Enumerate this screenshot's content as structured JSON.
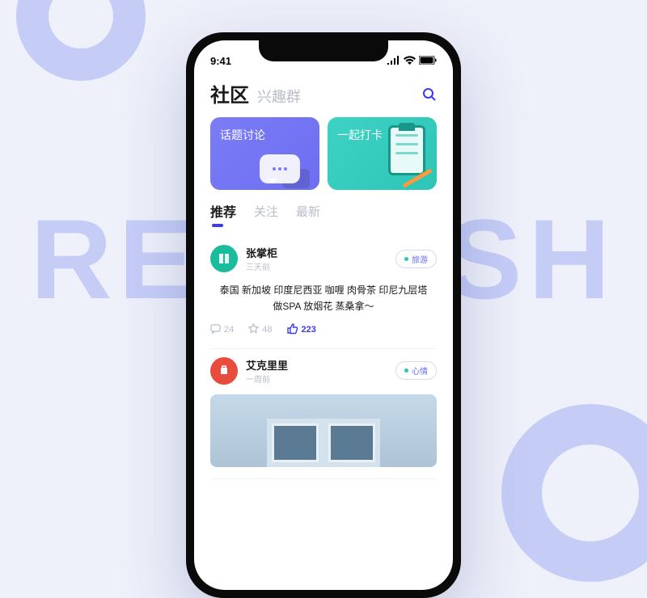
{
  "background_text": "REFRESH",
  "status": {
    "time": "9:41"
  },
  "header": {
    "title": "社区",
    "subtitle": "兴趣群"
  },
  "cards": [
    {
      "label": "话题讨论"
    },
    {
      "label": "一起打卡"
    }
  ],
  "tabs": [
    {
      "label": "推荐",
      "active": true
    },
    {
      "label": "关注",
      "active": false
    },
    {
      "label": "最新",
      "active": false
    }
  ],
  "posts": [
    {
      "user": "张掌柜",
      "time": "三天前",
      "tag": "旅游",
      "body_line1": "泰国 新加坡 印度尼西亚 咖喱 肉骨茶 印尼九层塔",
      "body_line2": "做SPA 放烟花 蒸桑拿～",
      "comments": "24",
      "favorites": "48",
      "likes": "223"
    },
    {
      "user": "艾克里里",
      "time": "一周前",
      "tag": "心情"
    }
  ]
}
